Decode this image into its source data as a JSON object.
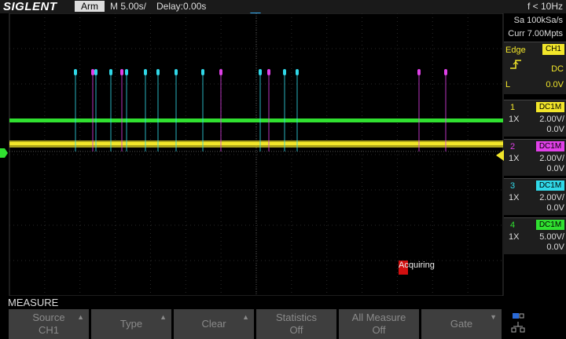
{
  "header": {
    "brand": "SIGLENT",
    "trigger_status": "Arm",
    "timebase": "M 5.00s/",
    "delay": "Delay:0.00s",
    "frequency": "f < 10Hz"
  },
  "acquisition": {
    "sample_rate": "Sa 100kSa/s",
    "memory_depth": "Curr 7.00Mpts"
  },
  "trigger": {
    "type": "Edge",
    "source": "CH1",
    "slope_icon": "rising-edge-icon",
    "coupling": "DC",
    "level_label": "L",
    "level": "0.0V"
  },
  "channels": [
    {
      "num": "1",
      "coupling": "DC1M",
      "probe": "1X",
      "scale": "2.00V/",
      "offset": "0.0V",
      "color": "#f2e62a"
    },
    {
      "num": "2",
      "coupling": "DC1M",
      "probe": "1X",
      "scale": "2.00V/",
      "offset": "0.0V",
      "color": "#e040e8"
    },
    {
      "num": "3",
      "coupling": "DC1M",
      "probe": "1X",
      "scale": "2.00V/",
      "offset": "0.0V",
      "color": "#30d8e8"
    },
    {
      "num": "4",
      "coupling": "DC1M",
      "probe": "1X",
      "scale": "5.00V/",
      "offset": "0.0V",
      "color": "#30e030"
    }
  ],
  "status_message": "Acquiring",
  "menu": {
    "title": "MEASURE",
    "softkeys": [
      {
        "line1": "Source",
        "line2": "CH1",
        "arrow": "▲"
      },
      {
        "line1": "Type",
        "line2": "",
        "arrow": "▲"
      },
      {
        "line1": "Clear",
        "line2": "",
        "arrow": "▲"
      },
      {
        "line1": "Statistics",
        "line2": "Off",
        "arrow": ""
      },
      {
        "line1": "All Measure",
        "line2": "Off",
        "arrow": ""
      },
      {
        "line1": "Gate",
        "line2": "",
        "arrow": "▼"
      }
    ]
  },
  "icons": {
    "network": "network-icon",
    "trigger_pos": "trigger-position-icon",
    "level_marker": "trigger-level-icon"
  },
  "colors": {
    "ch1": "#f2e62a",
    "ch2": "#e040e8",
    "ch3": "#30d8e8",
    "ch4": "#30e030",
    "accent": "#f2e62a"
  }
}
